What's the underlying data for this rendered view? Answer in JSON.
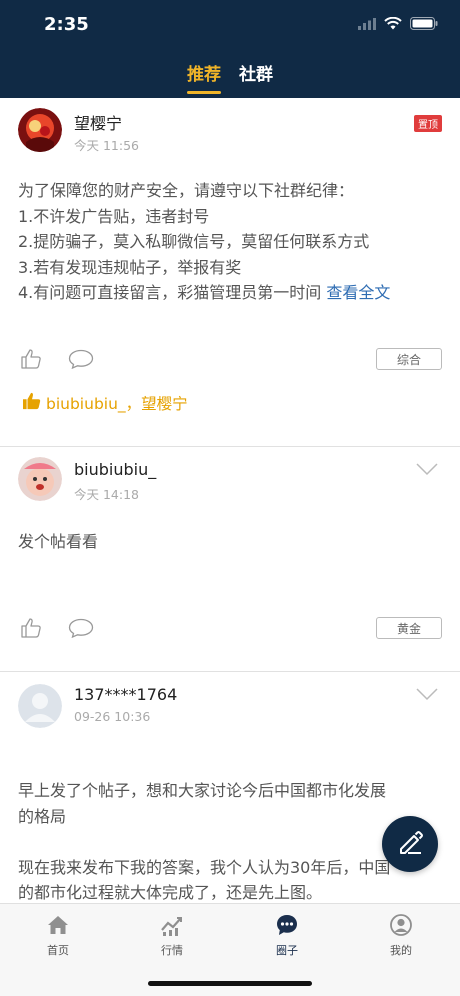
{
  "status_bar": {
    "time": "2:35"
  },
  "tabs": [
    {
      "label": "推荐",
      "active": true
    },
    {
      "label": "社群",
      "active": false
    }
  ],
  "posts": [
    {
      "author": "望樱宁",
      "time": "今天 11:56",
      "badge": "置顶",
      "content": [
        "为了保障您的财产安全，请遵守以下社群纪律：",
        "1.不许发广告贴，违者封号",
        "2.提防骗子，莫入私聊微信号，莫留任何联系方式",
        "3.若有发现违规帖子，举报有奖",
        "4.有问题可直接留言，彩猫管理员第一时间 "
      ],
      "more": "查看全文",
      "tag": "综合",
      "likers": "biubiubiu_，望樱宁"
    },
    {
      "author": "biubiubiu_",
      "time": "今天 14:18",
      "content": [
        "发个帖看看"
      ],
      "tag": "黄金"
    },
    {
      "author": "137****1764",
      "time": "09-26 10:36",
      "content": [
        "早上发了个帖子，想和大家讨论今后中国都市化发展",
        "的格局",
        "",
        "现在我来发布下我的答案，我个人认为30年后，中国",
        "的都市化过程就大体完成了，还是先上图。"
      ]
    }
  ],
  "bottom_nav": [
    {
      "label": "首页",
      "icon": "home-icon",
      "active": false
    },
    {
      "label": "行情",
      "icon": "chart-icon",
      "active": false
    },
    {
      "label": "圈子",
      "icon": "chat-bubble-icon",
      "active": true
    },
    {
      "label": "我的",
      "icon": "user-icon",
      "active": false
    }
  ],
  "colors": {
    "header": "#102a45",
    "accent": "#f0b429",
    "link": "#2f6db3",
    "pin": "#e03c3c"
  }
}
